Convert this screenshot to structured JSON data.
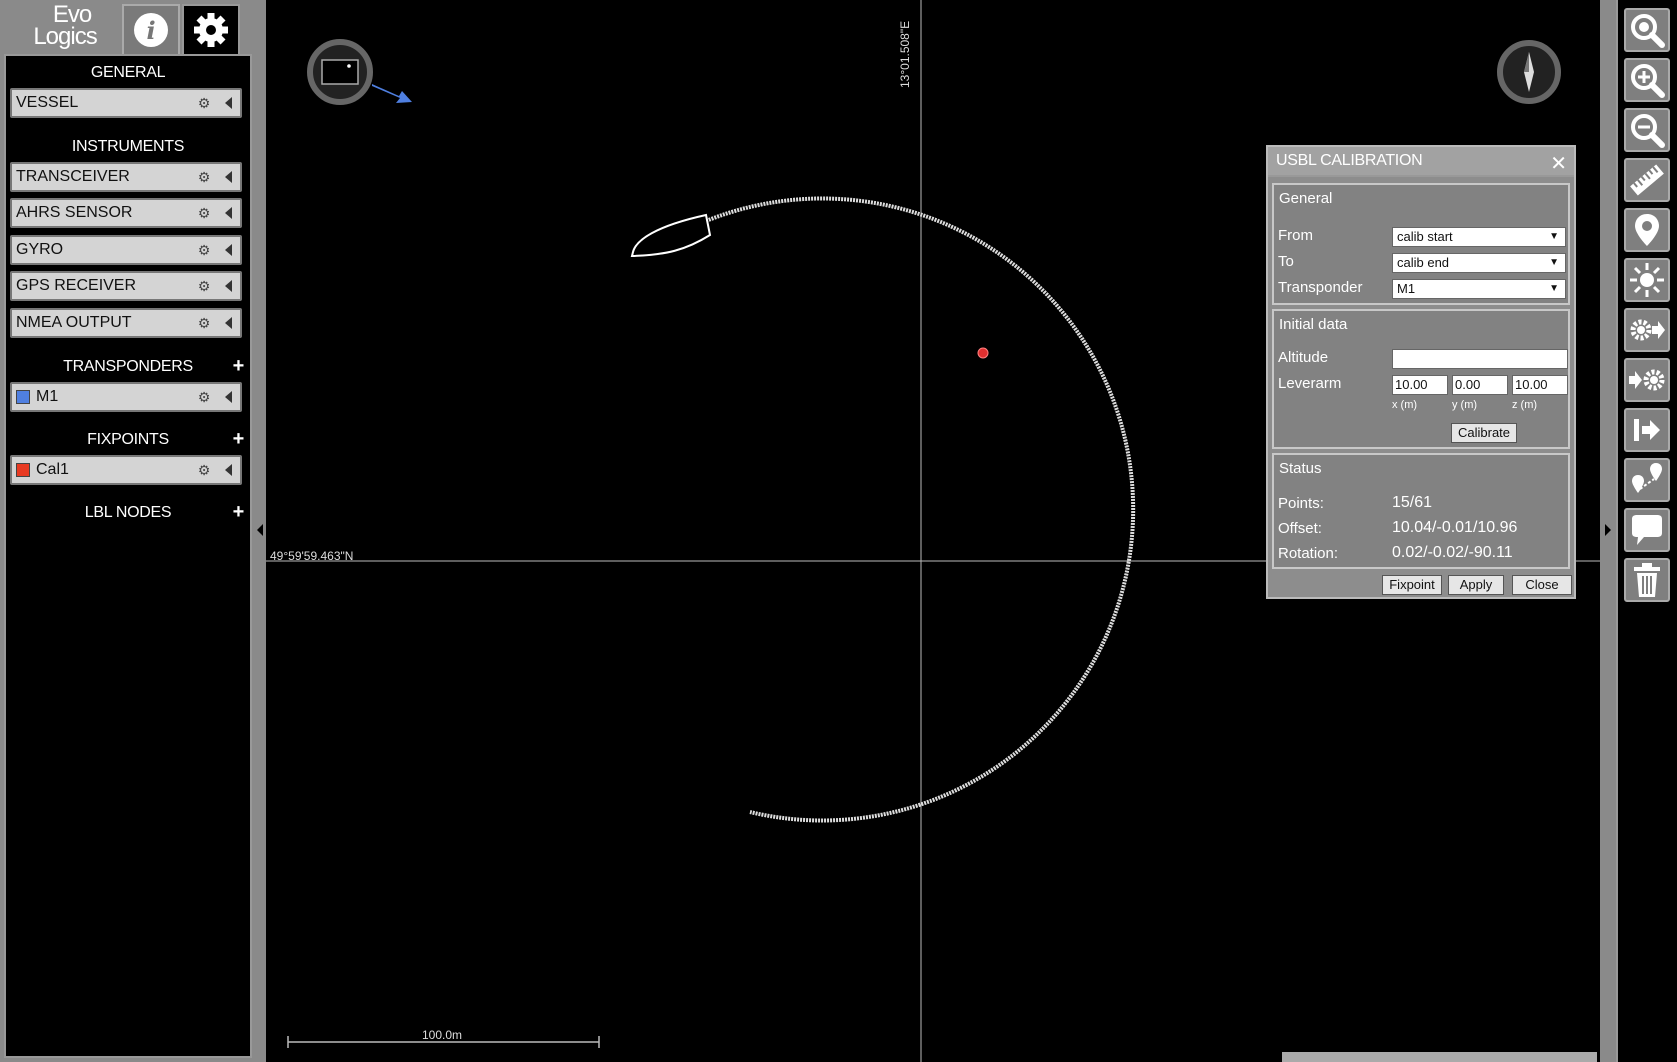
{
  "sidebar": {
    "logo_line1": "Evo",
    "logo_line2": "Logics",
    "sections": {
      "general": "GENERAL",
      "instruments": "INSTRUMENTS",
      "transponders": "TRANSPONDERS",
      "fixpoints": "FIXPOINTS",
      "lbl_nodes": "LBL NODES"
    },
    "items": {
      "vessel": "VESSEL",
      "transceiver": "TRANSCEIVER",
      "ahrs": "AHRS SENSOR",
      "gyro": "GYRO",
      "gps": "GPS RECEIVER",
      "nmea": "NMEA OUTPUT",
      "m1": "M1",
      "cal1": "Cal1"
    },
    "colors": {
      "m1_swatch": "#4f7fe0",
      "cal1_swatch": "#e83a22"
    }
  },
  "map": {
    "longitude_label": "13°01.508\"E",
    "latitude_label": "49°59'59.463\"N",
    "scale_label": "100.0m",
    "colors": {
      "track": "#ffffff",
      "fixpoint": "#e03030",
      "heading_arrow": "#4f7fe0"
    }
  },
  "dialog": {
    "title": "USBL CALIBRATION",
    "general": {
      "title": "General",
      "from_label": "From",
      "from_value": "calib start",
      "to_label": "To",
      "to_value": "calib end",
      "transponder_label": "Transponder",
      "transponder_value": "M1"
    },
    "initial": {
      "title": "Initial data",
      "altitude_label": "Altitude",
      "altitude_value": "",
      "leverarm_label": "Leverarm",
      "lever_x": "10.00",
      "lever_y": "0.00",
      "lever_z": "10.00",
      "x_label": "x (m)",
      "y_label": "y (m)",
      "z_label": "z (m)",
      "calibrate_label": "Calibrate"
    },
    "status": {
      "title": "Status",
      "points_label": "Points:",
      "points_value": "15/61",
      "offset_label": "Offset:",
      "offset_value": "10.04/-0.01/10.96",
      "rotation_label": "Rotation:",
      "rotation_value": "0.02/-0.02/-90.11"
    },
    "buttons": {
      "fixpoint": "Fixpoint",
      "apply": "Apply",
      "close": "Close"
    }
  },
  "toolbar": {
    "icons": [
      "zoom-fit-icon",
      "zoom-in-icon",
      "zoom-out-icon",
      "ruler-icon",
      "location-pin-icon",
      "sun-icon",
      "settings-export-icon",
      "settings-import-icon",
      "exit-icon",
      "waypoints-icon",
      "comment-icon",
      "trash-icon"
    ]
  }
}
